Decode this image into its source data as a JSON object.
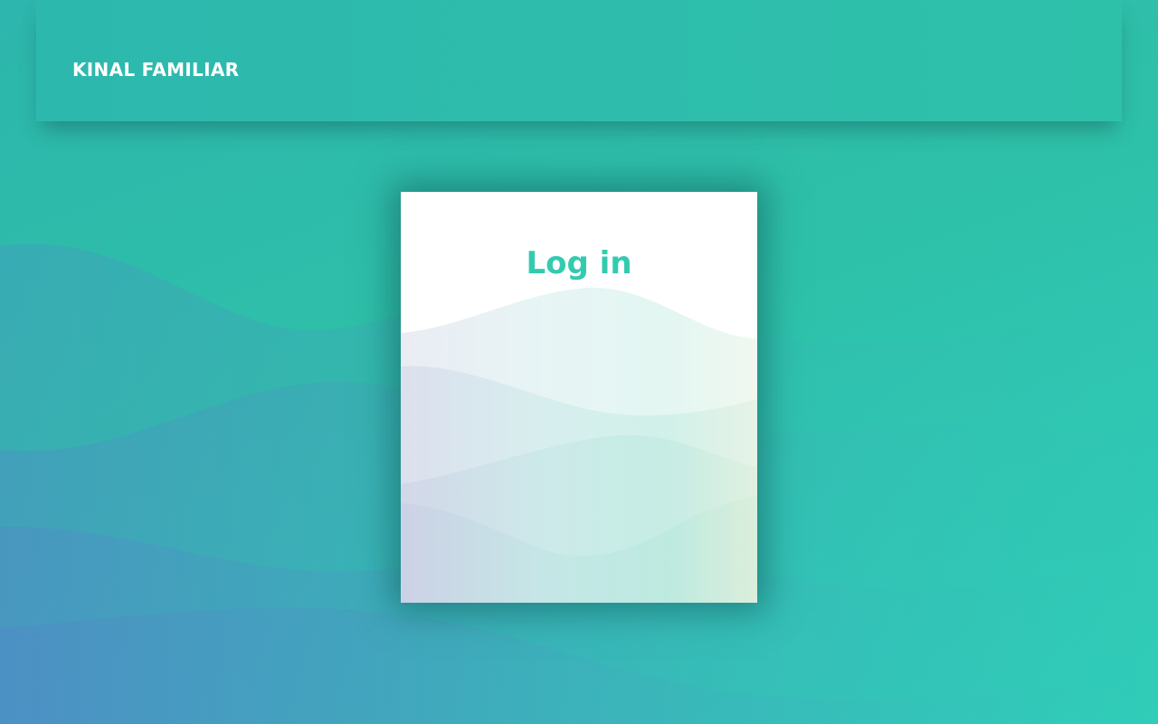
{
  "header": {
    "brand": "KINAL FAMILIAR"
  },
  "login_card": {
    "title": "Log in"
  },
  "colors": {
    "background_start": "#2db6ad",
    "background_end": "#30cdb9",
    "accent": "#33cbb0",
    "wave_blue": "#4f88c6",
    "card_background": "#ffffff",
    "brand_text": "#ffffff"
  }
}
